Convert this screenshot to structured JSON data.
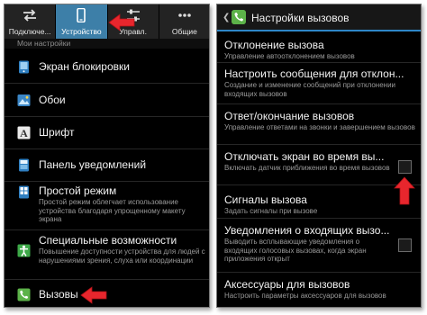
{
  "left": {
    "tabs": [
      {
        "label": "Подключе...",
        "icon": "arrows-swap-icon",
        "active": false
      },
      {
        "label": "Устройство",
        "icon": "phone-device-icon",
        "active": true
      },
      {
        "label": "Управл.",
        "icon": "sliders-icon",
        "active": false
      },
      {
        "label": "Общие",
        "icon": "dots-icon",
        "active": false
      }
    ],
    "subheader": "Мои настройки",
    "items": [
      {
        "title": "Экран блокировки",
        "desc": "",
        "icon": "lock-screen-icon"
      },
      {
        "title": "Обои",
        "desc": "",
        "icon": "wallpaper-icon"
      },
      {
        "title": "Шрифт",
        "desc": "",
        "icon": "font-icon"
      },
      {
        "title": "Панель уведомлений",
        "desc": "",
        "icon": "notification-panel-icon"
      },
      {
        "title": "Простой режим",
        "desc": "Простой режим облегчает использование устройства благодаря упрощенному макету экрана",
        "icon": "easy-mode-icon"
      },
      {
        "title": "Специальные возможности",
        "desc": "Повышение доступности устройства для людей с нарушениями зрения, слуха или координации",
        "icon": "accessibility-icon"
      },
      {
        "title": "Вызовы",
        "desc": "",
        "icon": "call-icon"
      }
    ]
  },
  "right": {
    "header_title": "Настройки вызовов",
    "items": [
      {
        "title": "Отклонение вызова",
        "desc": "Управление автоотклонением вызовов",
        "checkbox": false
      },
      {
        "title": "Настроить сообщения для отклон...",
        "desc": "Создание и изменение сообщений при отклонении входящих вызовов",
        "checkbox": false
      },
      {
        "title": "Ответ/окончание вызовов",
        "desc": "Управление ответами на звонки и завершением вызовов",
        "checkbox": false
      },
      {
        "title": "Отключать экран во время вы...",
        "desc": "Включать датчик приближения во время вызовов",
        "checkbox": true,
        "checked": false
      },
      {
        "title": "Сигналы вызова",
        "desc": "Задать сигналы при вызове",
        "checkbox": false
      },
      {
        "title": "Уведомления о входящих вызо...",
        "desc": "Выводить всплывающие уведомления о входящих голосовых вызовах, когда экран приложения открыт",
        "checkbox": true,
        "checked": false
      },
      {
        "title": "Аксессуары для вызовов",
        "desc": "Настроить параметры аксессуаров для вызовов",
        "checkbox": false
      }
    ]
  },
  "colors": {
    "active_tab": "#3d7fa8",
    "header_accent": "#2e87c8",
    "call_icon": "#5cb249",
    "annotation_arrow": "#e8262d"
  }
}
